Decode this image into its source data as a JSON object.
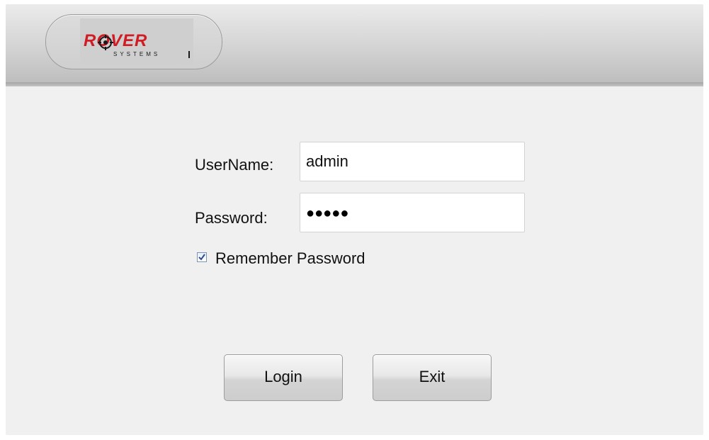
{
  "header": {
    "logo": {
      "text": "ROVER",
      "subtext": "SYSTEMS",
      "color": "#d01c24"
    }
  },
  "form": {
    "username_label": "UserName:",
    "username_value": "admin",
    "password_label": "Password:",
    "password_value_masked": "●●●●●",
    "remember_label": "Remember Password",
    "remember_checked": true
  },
  "buttons": {
    "login_label": "Login",
    "exit_label": "Exit"
  },
  "icons": {
    "logo_mark": "target-crosshair-icon",
    "checkbox": "checkbox-checked-icon"
  }
}
